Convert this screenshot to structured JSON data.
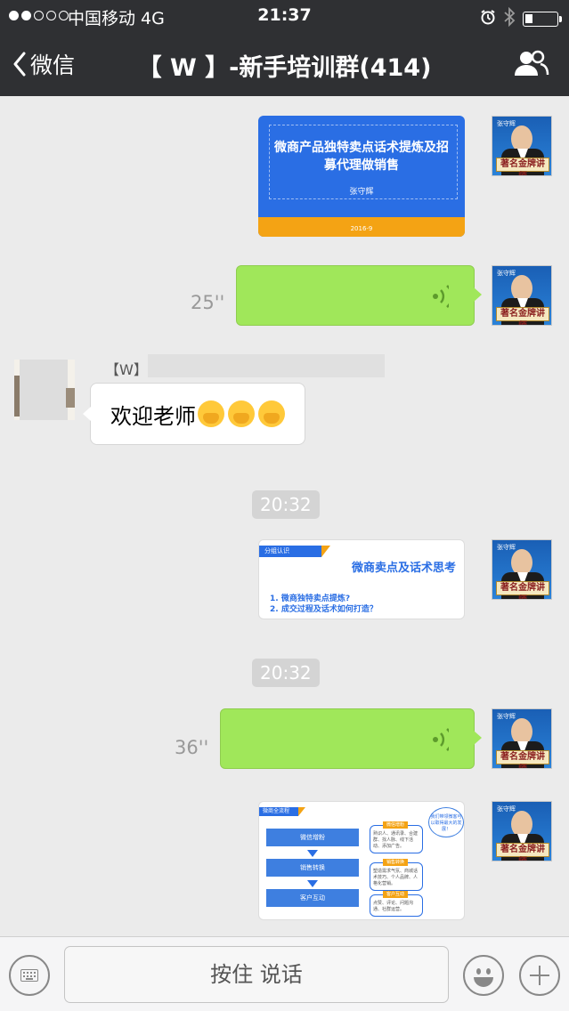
{
  "status_bar": {
    "signal_dots": [
      true,
      true,
      false,
      false,
      false
    ],
    "carrier": "中国移动  4G",
    "time": "21:37",
    "icons": [
      "alarm-icon",
      "bluetooth-icon",
      "battery-icon"
    ]
  },
  "nav": {
    "back_label": "微信",
    "title": "【 W 】-新手培训群(414)",
    "right_icon": "group-members-icon"
  },
  "messages": {
    "slide1": {
      "title": "微商产品独特卖点话术提炼及招募代理做销售",
      "author": "张守辉",
      "date": "2016-9"
    },
    "voice1": {
      "duration": "25''"
    },
    "incoming": {
      "sender": "【W】",
      "text": "欢迎老师"
    },
    "time1": "20:32",
    "slide2": {
      "header": "分组认识",
      "title": "微商卖点及话术思考",
      "line1": "1.   微商独特卖点提炼?",
      "line2": "2.   成交过程及话术如何打造？"
    },
    "time2": "20:32",
    "voice2": {
      "duration": "36''"
    },
    "slide3": {
      "header": "微商全流程",
      "boxes": [
        "微信增粉",
        "销售转换",
        "客户互动"
      ],
      "cards": [
        {
          "label": "微信增粉",
          "text": "熟识人、通讯录、合建群、找人脉、线下活动、添加广告。"
        },
        {
          "label": "销售转换",
          "text": "塑造需求气氛、商城话术技巧、个人品牌、人格化营销。"
        },
        {
          "label": "客户互动",
          "text": "点赞、评论、问题沟通、社群运营。"
        }
      ],
      "cloud": "我们带领微客可以取得最大的发展！"
    },
    "avatar_caption": "著名金牌讲师",
    "avatar_tag": "张守辉"
  },
  "input_bar": {
    "hold_to_talk": "按住 说话"
  },
  "colors": {
    "header_bg": "#2f3033",
    "chat_bg": "#ebebeb",
    "voice_bubble": "#a0e75a",
    "slide_blue": "#2a6ee4",
    "slide_orange": "#f4a314"
  }
}
